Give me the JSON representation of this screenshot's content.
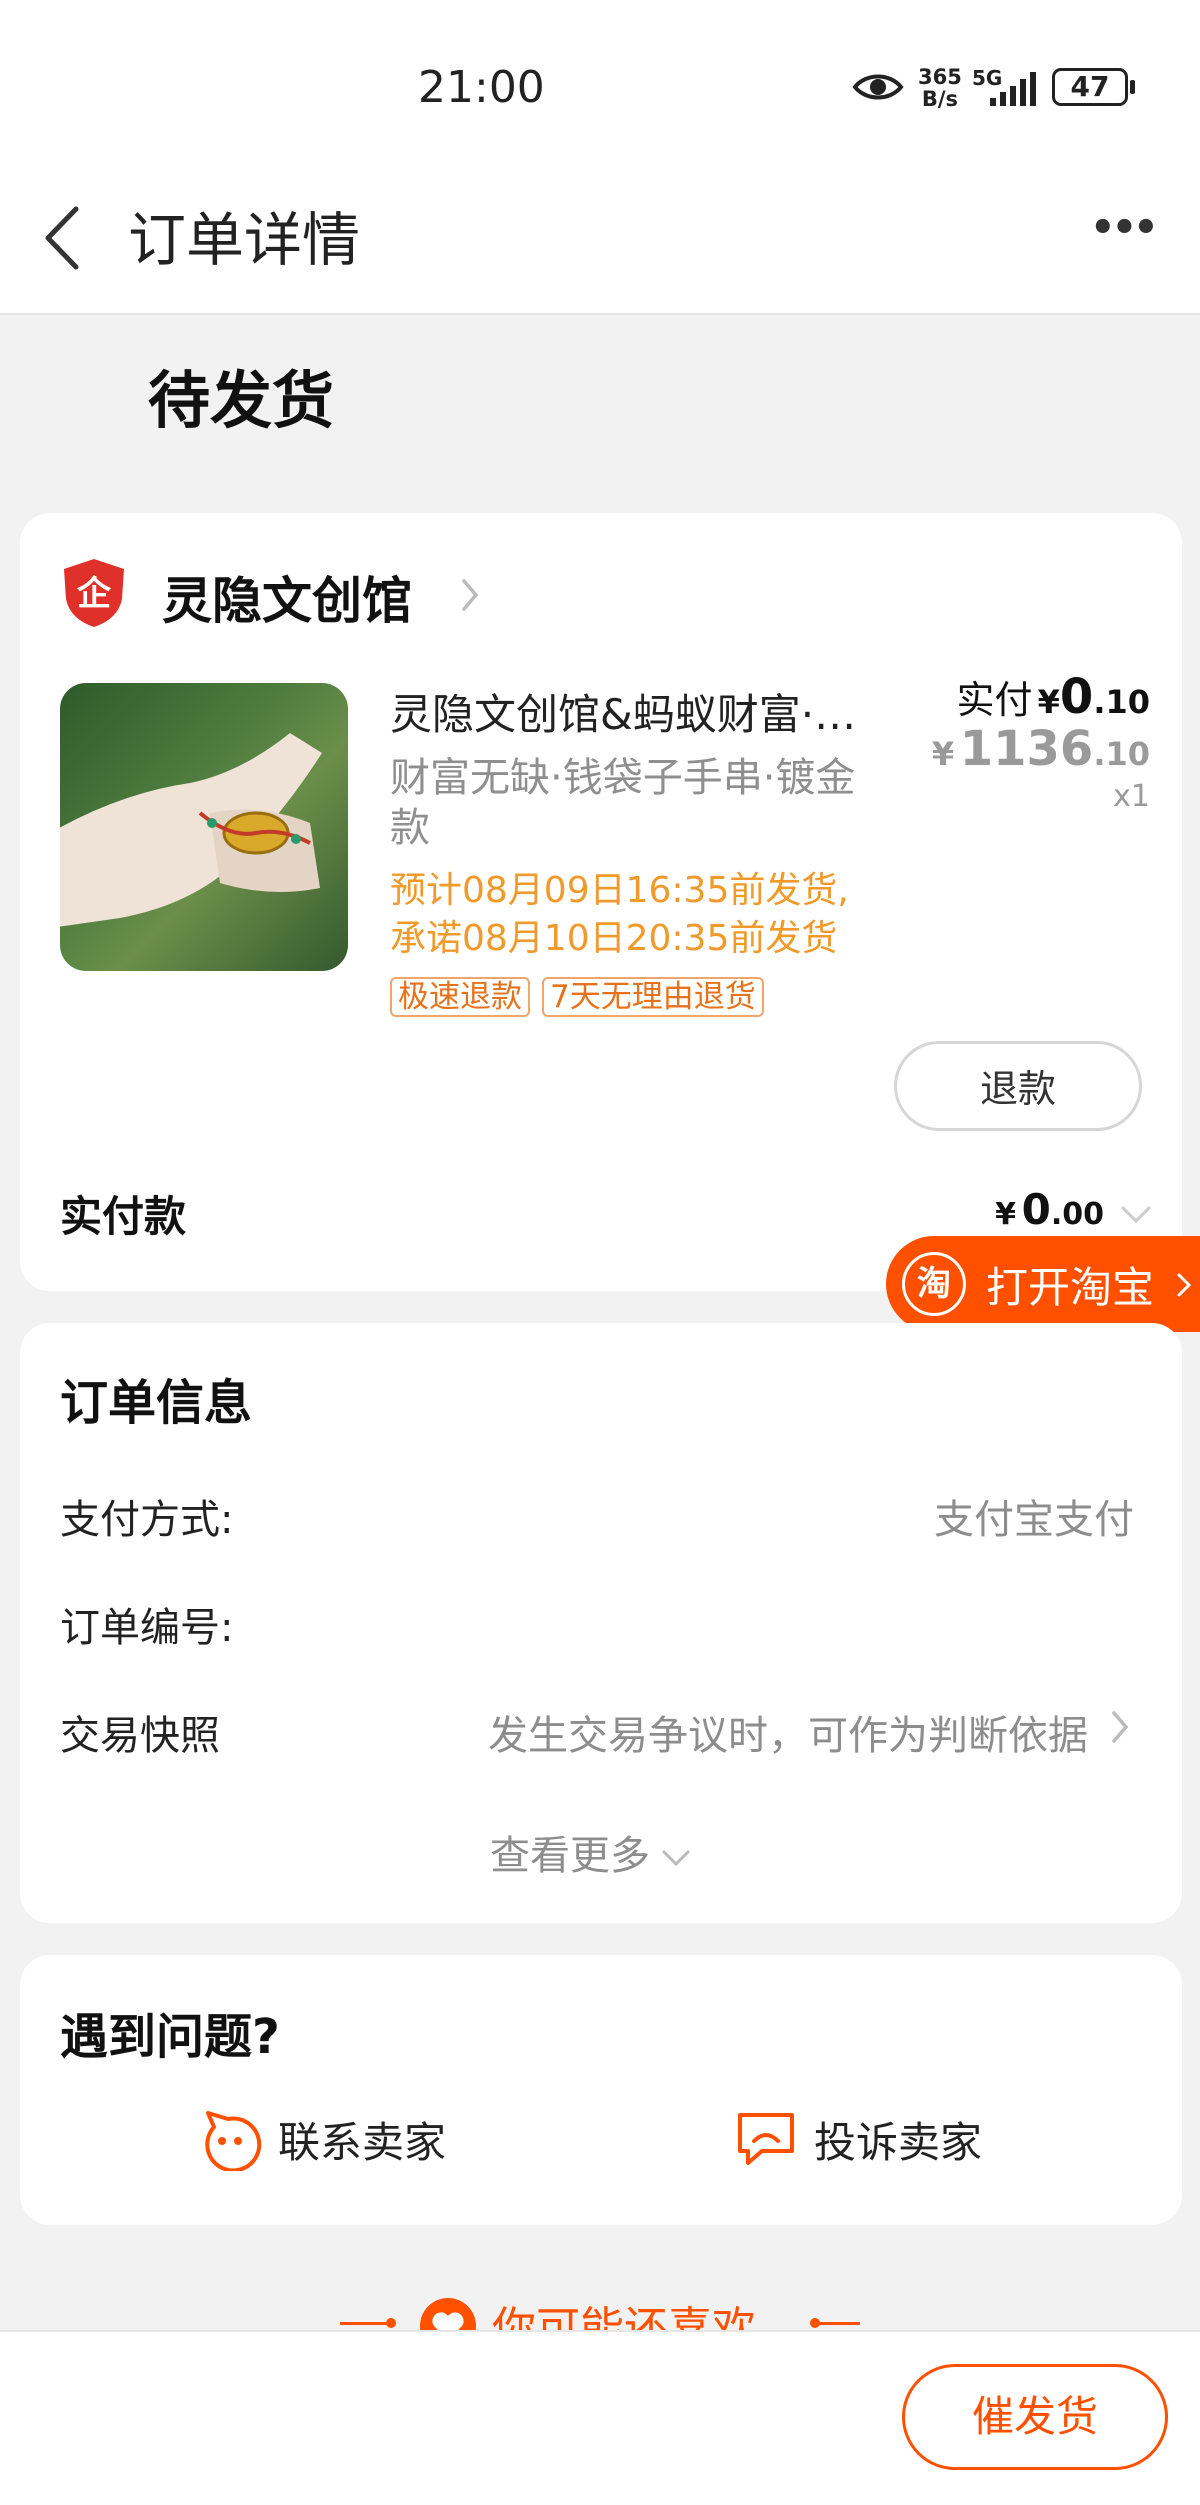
{
  "status_bar": {
    "time": "21:00",
    "net_speed_top": "365",
    "net_speed_bottom": "B/s",
    "network": "5G",
    "battery": "47"
  },
  "nav": {
    "title": "订单详情",
    "more": "•••"
  },
  "order_status": "待发货",
  "shop": {
    "name": "灵隐文创馆",
    "logo_char": "企",
    "product": {
      "title": "灵隐文创馆&蚂蚁财富·…",
      "subtitle": "财富无缺·钱袋子手串·镀金款",
      "delivery_line1": "预计08月09日16:35前发货,",
      "delivery_line2": "承诺08月10日20:35前发货",
      "tags": [
        "极速退款",
        "7天无理由退货"
      ],
      "paid_label": "实付",
      "currency": "¥",
      "paid_int": "0",
      "paid_dec": ".10",
      "orig_int": "1136",
      "orig_dec": ".10",
      "quantity": "x1"
    },
    "refund_button": "退款",
    "total_label": "实付款",
    "total_currency": "¥",
    "total_int": "0",
    "total_dec": ".00"
  },
  "open_taobao": {
    "icon_char": "淘",
    "label": "打开淘宝"
  },
  "order_info": {
    "title": "订单信息",
    "rows": [
      {
        "label": "支付方式:",
        "value": "支付宝支付"
      },
      {
        "label": "订单编号:",
        "value": ""
      },
      {
        "label": "交易快照",
        "value": "发生交易争议时，可作为判断依据"
      }
    ],
    "view_more": "查看更多"
  },
  "help": {
    "title": "遇到问题?",
    "contact": "联系卖家",
    "complain": "投诉卖家"
  },
  "recommend": {
    "title": "你可能还喜欢"
  },
  "bottom": {
    "urge_button": "催发货"
  },
  "colors": {
    "accent": "#ff5000",
    "brand_red": "#e0302a",
    "warning": "#f19a2b"
  }
}
